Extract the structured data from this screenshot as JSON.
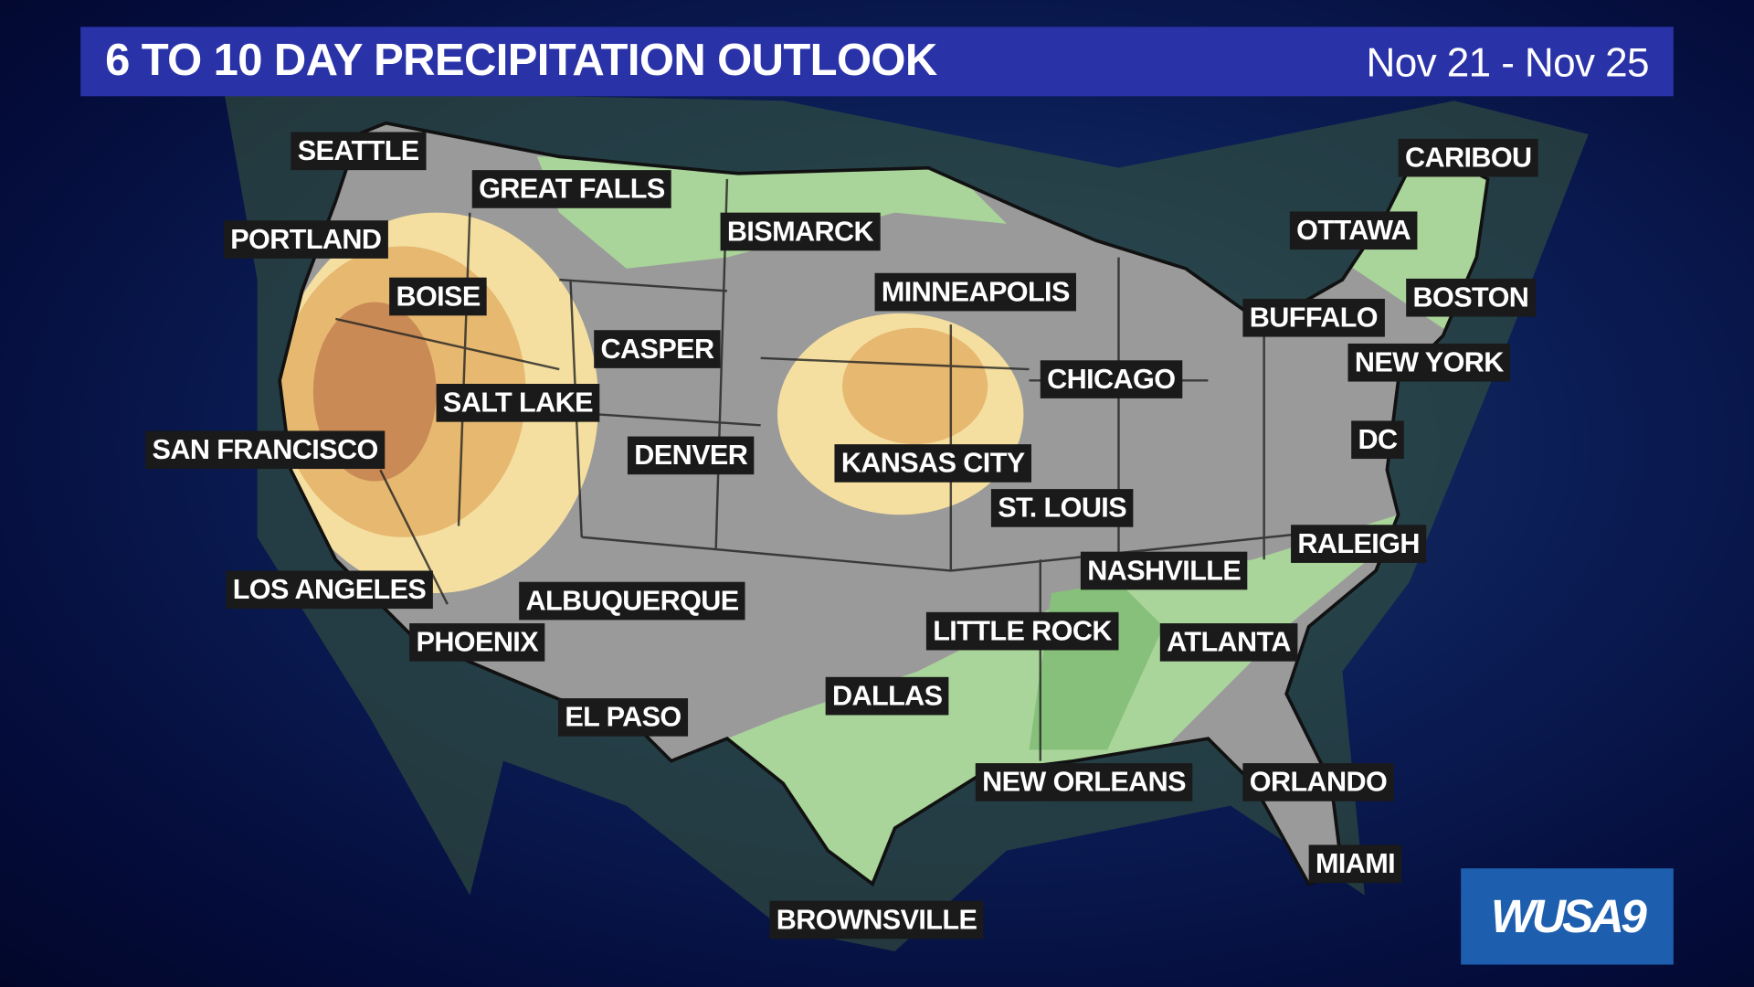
{
  "header": {
    "title": "6 TO 10 DAY PRECIPITATION OUTLOOK",
    "dates": "Nov 21 - Nov 25"
  },
  "legend_colors": {
    "below_normal_light": "#f5dfa0",
    "below_normal_mid": "#e6b870",
    "below_normal_strong": "#c98a55",
    "above_normal_light": "#a9d49a",
    "above_normal_mid": "#86c07a",
    "near_normal": "#9a9a9a",
    "title_bar": "#2a32a8"
  },
  "cities": [
    "SEATTLE",
    "GREAT FALLS",
    "PORTLAND",
    "BOISE",
    "BISMARCK",
    "MINNEAPOLIS",
    "CASPER",
    "SALT LAKE",
    "SAN FRANCISCO",
    "DENVER",
    "KANSAS CITY",
    "CHICAGO",
    "ST. LOUIS",
    "LOS ANGELES",
    "ALBUQUERQUE",
    "PHOENIX",
    "EL PASO",
    "DALLAS",
    "LITTLE ROCK",
    "NASHVILLE",
    "ATLANTA",
    "RALEIGH",
    "NEW ORLEANS",
    "ORLANDO",
    "MIAMI",
    "BROWNSVILLE",
    "CARIBOU",
    "OTTAWA",
    "BOSTON",
    "BUFFALO",
    "NEW YORK",
    "DC"
  ],
  "logo": "WUSA9"
}
